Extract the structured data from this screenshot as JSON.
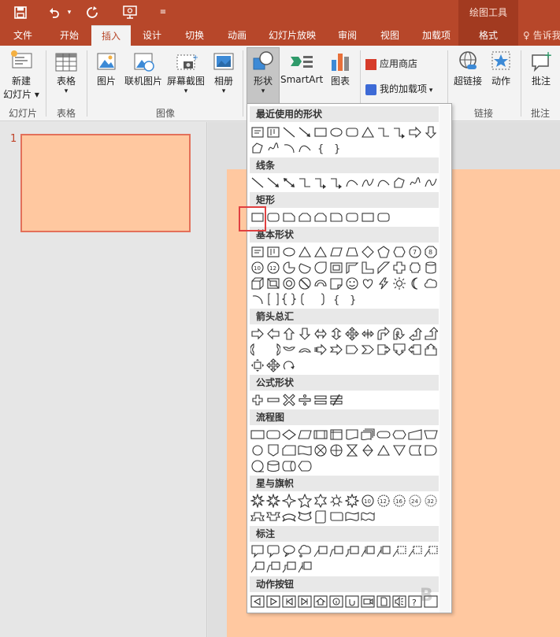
{
  "title_bar": {
    "contextual_tool_title": "绘图工具",
    "qat_icons": [
      "save-icon",
      "undo-icon",
      "dropdown-arrow-icon",
      "redo-icon",
      "present-icon",
      "customize-qat-icon"
    ]
  },
  "tabs": [
    {
      "label": "文件",
      "active": false
    },
    {
      "label": "开始",
      "active": false
    },
    {
      "label": "插入",
      "active": true
    },
    {
      "label": "设计",
      "active": false
    },
    {
      "label": "切换",
      "active": false
    },
    {
      "label": "动画",
      "active": false
    },
    {
      "label": "幻灯片放映",
      "active": false
    },
    {
      "label": "审阅",
      "active": false
    },
    {
      "label": "视图",
      "active": false
    },
    {
      "label": "加载项",
      "active": false
    },
    {
      "label": "格式",
      "active": false
    }
  ],
  "tell_me": "告诉我",
  "ribbon": {
    "new_slide_line1": "新建",
    "new_slide_line2": "幻灯片",
    "group_slides": "幻灯片",
    "table": "表格",
    "group_tables": "表格",
    "picture": "图片",
    "online_picture": "联机图片",
    "screenshot": "屏幕截图",
    "album": "相册",
    "group_images": "图像",
    "shapes": "形状",
    "smartart": "SmartArt",
    "chart": "图表",
    "app_store": "应用商店",
    "my_addins": "我的加载项",
    "hyperlink": "超链接",
    "action": "动作",
    "group_links": "链接",
    "comment": "批注",
    "group_comments": "批注"
  },
  "thumbnail_pane": {
    "slide_number": "1",
    "slide_color": "#ffc8a0"
  },
  "gallery": {
    "categories": {
      "recent": "最近使用的形状",
      "lines": "线条",
      "rect": "矩形",
      "basic": "基本形状",
      "arrows": "箭头总汇",
      "equation": "公式形状",
      "flowchart": "流程图",
      "stars": "星与旗帜",
      "callouts": "标注",
      "actions": "动作按钮"
    },
    "brace_left": "{",
    "brace_right": "}",
    "selected_shape": "矩形"
  },
  "colors": {
    "accent": "#b7472a",
    "slide_bg": "#ffc8a0",
    "selection": "#e04040"
  }
}
